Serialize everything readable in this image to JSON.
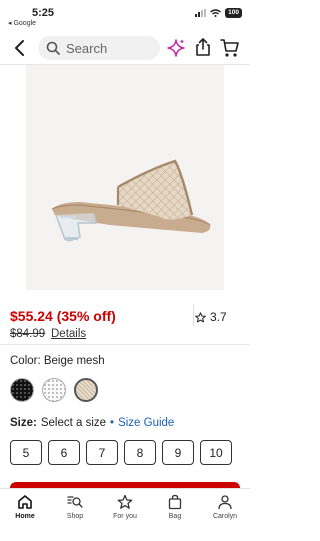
{
  "status": {
    "time": "5:25",
    "back_app": "◂ Google",
    "battery": "100"
  },
  "header": {
    "search_placeholder": "Search",
    "icons": [
      "back-chevron-icon",
      "search-icon",
      "sparkle-icon",
      "share-icon",
      "cart-icon"
    ]
  },
  "product": {
    "price_current": "$55.24 (35% off)",
    "price_original": "$84.99",
    "details_link": "Details",
    "rating": "3.7",
    "color_label": "Color: Beige mesh",
    "swatches": [
      "black",
      "white",
      "beige"
    ],
    "selected_swatch": "beige"
  },
  "size": {
    "label": "Size:",
    "prompt": "Select a size",
    "separator": "•",
    "guide": "Size Guide",
    "options": [
      "5",
      "6",
      "7",
      "8",
      "9",
      "10"
    ]
  },
  "tabs": [
    {
      "label": "Home",
      "icon": "home-icon",
      "active": true
    },
    {
      "label": "Shop",
      "icon": "shop-search-icon",
      "active": false
    },
    {
      "label": "For you",
      "icon": "star-icon",
      "active": false
    },
    {
      "label": "Bag",
      "icon": "bag-icon",
      "active": false
    },
    {
      "label": "Carolyn",
      "icon": "profile-icon",
      "active": false
    }
  ],
  "colors": {
    "accent": "#cc0000",
    "link": "#1a5fb4",
    "sparkle": "#c02aa8"
  }
}
